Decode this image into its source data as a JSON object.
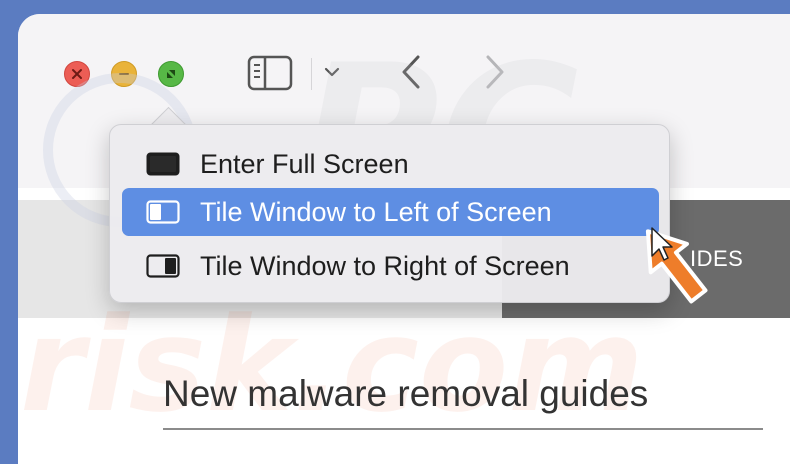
{
  "colors": {
    "accent": "#5e8ee3",
    "close": "#ec5d55",
    "minimize": "#e9b33a",
    "zoom": "#57b846",
    "pointer": "#ee7d2a"
  },
  "toolbar": {
    "icons": [
      "close-icon",
      "minimize-icon",
      "zoom-icon",
      "sidebar-icon",
      "chevron-down-icon",
      "back-icon",
      "forward-icon"
    ]
  },
  "menu": {
    "items": [
      {
        "label": "Enter Full Screen",
        "icon": "full-screen-icon",
        "selected": false
      },
      {
        "label": "Tile Window to Left of Screen",
        "icon": "tile-left-icon",
        "selected": true
      },
      {
        "label": "Tile Window to Right of Screen",
        "icon": "tile-right-icon",
        "selected": false
      }
    ]
  },
  "site": {
    "nav_partial": "IDES",
    "headline": "New malware removal guides",
    "watermark": "pcrisk.com"
  }
}
